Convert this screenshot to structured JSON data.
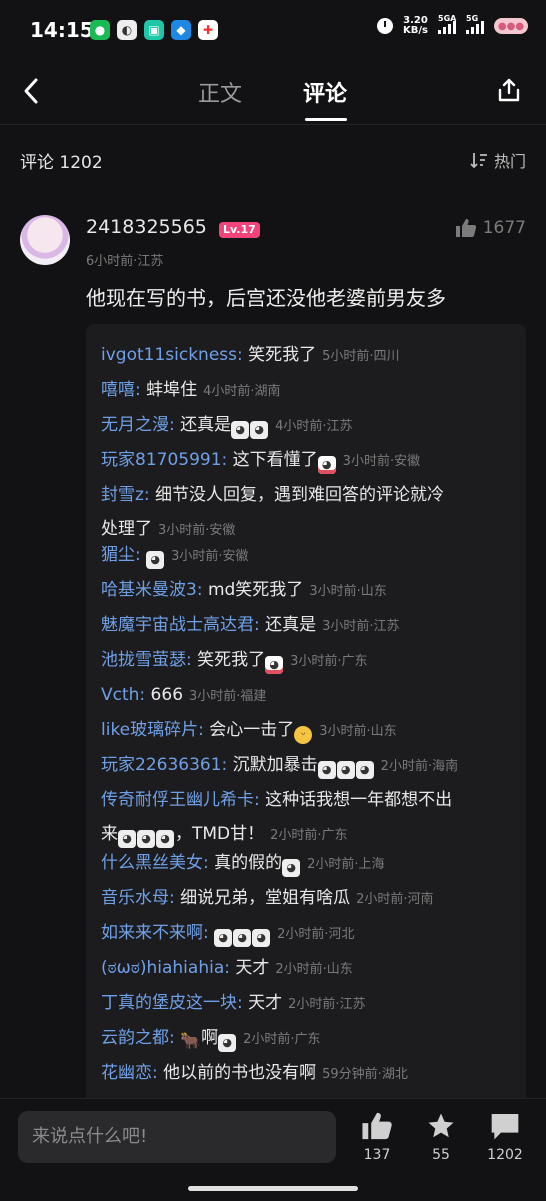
{
  "status_bar": {
    "time": "14:15",
    "net_speed_value": "3.20",
    "net_speed_unit": "KB/s",
    "signal1_label": "5GA",
    "signal2_label": "5G"
  },
  "header": {
    "tab_text": "正文",
    "tab_comments": "评论"
  },
  "comments_header": {
    "count_label": "评论 1202",
    "sort_label": "热门"
  },
  "main_comment": {
    "username": "2418325565",
    "level": "Lv.17",
    "likes": "1677",
    "meta": "6小时前·江苏",
    "text": "他现在写的书，后宫还没他老婆前男友多"
  },
  "replies": [
    {
      "name": "ivgot11sickness:",
      "text": " 笑死我了",
      "meta": "5小时前·四川"
    },
    {
      "name": "嘻嘻:",
      "text": " 蚌埠住",
      "meta": "4小时前·湖南"
    },
    {
      "name": "无月之漫:",
      "text": " 还真是",
      "meta": "4小时前·江苏"
    },
    {
      "name": "玩家81705991:",
      "text": " 这下看懂了",
      "meta": "3小时前·安徽"
    },
    {
      "name": "封雪z:",
      "text": " 细节没人回复，遇到难回答的评论就冷",
      "text2": "处理了",
      "meta": "3小时前·安徽"
    },
    {
      "name": "猸尘:",
      "text": " ",
      "meta": "3小时前·安徽"
    },
    {
      "name": "哈基米曼波3:",
      "text": " md笑死我了",
      "meta": "3小时前·山东"
    },
    {
      "name": "魅魔宇宙战士高达君:",
      "text": " 还真是",
      "meta": "3小时前·江苏"
    },
    {
      "name": "池拢雪萤瑟:",
      "text": " 笑死我了",
      "meta": "3小时前·广东"
    },
    {
      "name": "Vcth:",
      "text": " 666",
      "meta": "3小时前·福建"
    },
    {
      "name": "like玻璃碎片:",
      "text": " 会心一击了",
      "meta": "3小时前·山东"
    },
    {
      "name": "玩家22636361:",
      "text": " 沉默加暴击",
      "meta": "2小时前·海南"
    },
    {
      "name": "传奇耐俘王幽儿希卡:",
      "text": " 这种话我想一年都想不出",
      "text2_pre": "来",
      "text2": "，TMD甘！",
      "meta": "2小时前·广东"
    },
    {
      "name": "什么黑丝美女:",
      "text": " 真的假的",
      "meta": "2小时前·上海"
    },
    {
      "name": "音乐水母:",
      "text": " 细说兄弟，堂姐有啥瓜",
      "meta": "2小时前·河南"
    },
    {
      "name": "如来来不来啊:",
      "text": " ",
      "meta": "2小时前·河北"
    },
    {
      "name": "(ಠωಠ)hiahiahia:",
      "text": " 天才",
      "meta": "2小时前·山东"
    },
    {
      "name": "丁真的堡皮这一块:",
      "text": " 天才",
      "meta": "2小时前·江苏"
    },
    {
      "name": "云韵之都:",
      "text": " ",
      "text_after": "啊",
      "meta": "2小时前·广东"
    },
    {
      "name": "花幽恋:",
      "text": " 他以前的书也没有啊",
      "meta": "59分钟前·湖北"
    }
  ],
  "bottom_bar": {
    "input_placeholder": "来说点什么吧!",
    "likes": "137",
    "favorites": "55",
    "comments": "1202"
  },
  "colors": {
    "background": "#121214",
    "reply_name": "#6fa0e6",
    "level_badge": "#f0447a"
  }
}
